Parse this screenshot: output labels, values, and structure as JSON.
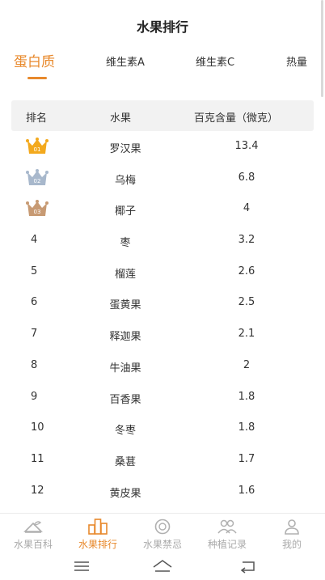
{
  "page_title": "水果排行",
  "tabs": [
    {
      "label": "蛋白质",
      "active": true
    },
    {
      "label": "维生素A",
      "active": false
    },
    {
      "label": "维生素C",
      "active": false
    },
    {
      "label": "热量",
      "active": false
    }
  ],
  "table": {
    "headers": {
      "rank": "排名",
      "fruit": "水果",
      "amount": "百克含量（微克）"
    },
    "rows": [
      {
        "rank": "01",
        "fruit": "罗汉果",
        "amount": "13.4",
        "crown": "gold-crown-icon"
      },
      {
        "rank": "02",
        "fruit": "乌梅",
        "amount": "6.8",
        "crown": "silver-crown-icon"
      },
      {
        "rank": "03",
        "fruit": "椰子",
        "amount": "4",
        "crown": "bronze-crown-icon"
      },
      {
        "rank": "4",
        "fruit": "枣",
        "amount": "3.2"
      },
      {
        "rank": "5",
        "fruit": "榴莲",
        "amount": "2.6"
      },
      {
        "rank": "6",
        "fruit": "蛋黄果",
        "amount": "2.5"
      },
      {
        "rank": "7",
        "fruit": "释迦果",
        "amount": "2.1"
      },
      {
        "rank": "8",
        "fruit": "牛油果",
        "amount": "2"
      },
      {
        "rank": "9",
        "fruit": "百香果",
        "amount": "1.8"
      },
      {
        "rank": "10",
        "fruit": "冬枣",
        "amount": "1.8"
      },
      {
        "rank": "11",
        "fruit": "桑葚",
        "amount": "1.7"
      },
      {
        "rank": "12",
        "fruit": "黄皮果",
        "amount": "1.6"
      }
    ]
  },
  "bottom_nav": [
    {
      "label": "水果百科",
      "icon": "fruit-encyclopedia-icon",
      "active": false
    },
    {
      "label": "水果排行",
      "icon": "ranking-icon",
      "active": true
    },
    {
      "label": "水果禁忌",
      "icon": "taboo-icon",
      "active": false
    },
    {
      "label": "种植记录",
      "icon": "planting-record-icon",
      "active": false
    },
    {
      "label": "我的",
      "icon": "profile-icon",
      "active": false
    }
  ],
  "colors": {
    "accent": "#e8892c",
    "gold": "#f3a91d",
    "silver": "#a8b8cc",
    "bronze": "#c79a73"
  }
}
